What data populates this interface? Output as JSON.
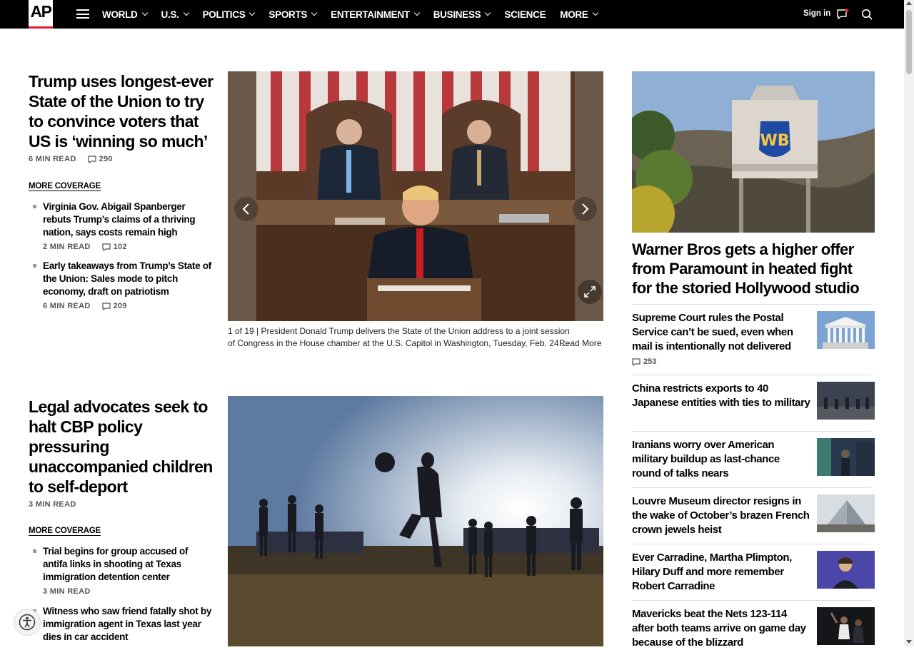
{
  "header": {
    "logo": "AP",
    "nav": [
      {
        "label": "WORLD",
        "dropdown": true
      },
      {
        "label": "U.S.",
        "dropdown": true
      },
      {
        "label": "POLITICS",
        "dropdown": true
      },
      {
        "label": "SPORTS",
        "dropdown": true
      },
      {
        "label": "ENTERTAINMENT",
        "dropdown": true
      },
      {
        "label": "BUSINESS",
        "dropdown": true
      },
      {
        "label": "SCIENCE",
        "dropdown": false
      },
      {
        "label": "MORE",
        "dropdown": true
      }
    ],
    "signin": "Sign in",
    "icons": [
      "menu-icon",
      "chat-icon",
      "search-icon"
    ],
    "accent": "#e21d30"
  },
  "lead1": {
    "headline": "Trump uses longest-ever State of the Union to try to convince voters that US is ‘winning so much’",
    "read_time": "6 MIN READ",
    "comments": "290",
    "more_coverage": "MORE COVERAGE",
    "related": [
      {
        "title": "Virginia Gov. Abigail Spanberger rebuts Trump’s claims of a thriving nation, says costs remain high",
        "read_time": "2 MIN READ",
        "comments": "102"
      },
      {
        "title": "Early takeaways from Trump’s State of the Union: Sales mode to pitch economy, draft on patriotism",
        "read_time": "6 MIN READ",
        "comments": "209"
      }
    ],
    "gallery": {
      "counter": "1 of 19 |",
      "caption": "President Donald Trump delivers the State of the Union address to a joint session of Congress in the House chamber at the U.S. Capitol in Washington, Tuesday, Feb. 24 ...",
      "read_more": "Read More"
    }
  },
  "lead2": {
    "headline": "Legal advocates seek to halt CBP policy pressuring unaccompanied children to self-deport",
    "read_time": "3 MIN READ",
    "more_coverage": "MORE COVERAGE",
    "related": [
      {
        "title": "Trial begins for group accused of antifa links in shooting at Texas immigration detention center",
        "read_time": "3 MIN READ"
      },
      {
        "title": "Witness who saw friend fatally shot by immigration agent in Texas last year dies in car accident",
        "read_time": ""
      }
    ]
  },
  "sidebar": {
    "main_headline": "Warner Bros gets a higher offer from Paramount in heated fight for the storied Hollywood studio",
    "items": [
      {
        "title": "Supreme Court rules the Postal Service can’t be sued, even when mail is intentionally not delivered",
        "comments": "253"
      },
      {
        "title": "China restricts exports to 40 Japanese entities with ties to military",
        "comments": ""
      },
      {
        "title": "Iranians worry over American military buildup as last-chance round of talks nears",
        "comments": ""
      },
      {
        "title": "Louvre Museum director resigns in the wake of October’s brazen French crown jewels heist",
        "comments": ""
      },
      {
        "title": "Ever Carradine, Martha Plimpton, Hilary Duff and more remember Robert Carradine",
        "comments": ""
      },
      {
        "title": "Mavericks beat the Nets 123-114 after both teams arrive on game day because of the blizzard",
        "comments": ""
      }
    ]
  }
}
